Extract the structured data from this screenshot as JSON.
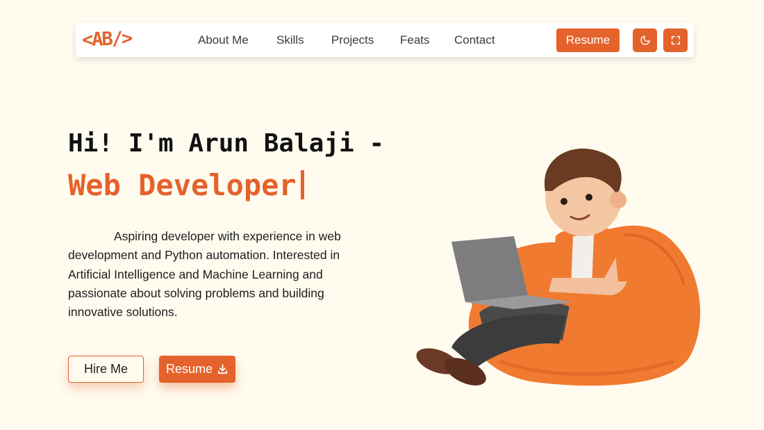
{
  "navbar": {
    "logo": "<AB/>",
    "links": [
      "About Me",
      "Skills",
      "Projects",
      "Feats",
      "Contact"
    ],
    "resume_label": "Resume",
    "theme_icon": "moon-icon",
    "fullscreen_icon": "fullscreen-icon"
  },
  "hero": {
    "greeting": "Hi! I'm Arun Balaji -",
    "role": "Web Developer",
    "bio": "Aspiring developer with experience in web development and Python automation. Interested in Artificial Intelligence and Machine Learning and passionate about solving problems and building innovative solutions.",
    "hire_label": "Hire Me",
    "resume_label": "Resume",
    "resume_icon": "download-icon"
  },
  "colors": {
    "accent": "#e4622b",
    "background": "#fffbef"
  }
}
